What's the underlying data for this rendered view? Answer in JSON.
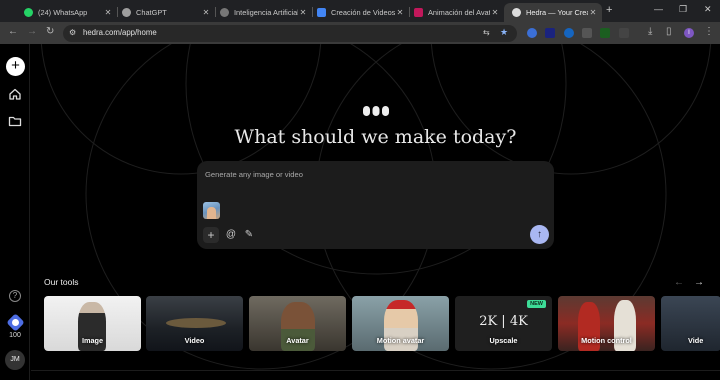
{
  "browser": {
    "tabs": [
      {
        "title": "(24) WhatsApp",
        "icon": "whatsapp-icon",
        "color": "#25d366",
        "active": false
      },
      {
        "title": "ChatGPT",
        "icon": "chatgpt-icon",
        "color": "#9e9e9e",
        "active": false
      },
      {
        "title": "Inteligencia Artificial y",
        "icon": "globe-icon",
        "color": "#8a8a8a",
        "active": false
      },
      {
        "title": "Creación de Videos",
        "icon": "docs-icon",
        "color": "#4285f4",
        "active": false
      },
      {
        "title": "Animación del Avatar",
        "icon": "video-app-icon",
        "color": "#c2185b",
        "active": false
      },
      {
        "title": "Hedra — Your Creati",
        "icon": "hedra-icon",
        "color": "#dddddd",
        "active": true
      }
    ],
    "new_tab": "+",
    "url": "hedra.com/app/home",
    "profile_initial": "I"
  },
  "sidebar": {
    "new_label": "+",
    "credits": "100",
    "user_initials": "JM",
    "help": "?"
  },
  "main": {
    "headline": "What should we make today?",
    "prompt_placeholder": "Generate any image or video",
    "prompt_buttons": {
      "add": "+",
      "mention": "@",
      "enhance": "✎"
    },
    "send_icon": "↑",
    "tools_title": "Our tools",
    "tools": [
      {
        "label": "Image",
        "badge": ""
      },
      {
        "label": "Video",
        "badge": ""
      },
      {
        "label": "Avatar",
        "badge": ""
      },
      {
        "label": "Motion avatar",
        "badge": ""
      },
      {
        "label": "Upscale",
        "badge": "NEW",
        "overlay": "2K | 4K"
      },
      {
        "label": "Motion control",
        "badge": ""
      },
      {
        "label": "Vide",
        "badge": ""
      }
    ],
    "colors": {
      "send_button": "#a9b7f2",
      "new_badge": "#3ddc97",
      "credits_icon": "#4d6de3"
    }
  }
}
